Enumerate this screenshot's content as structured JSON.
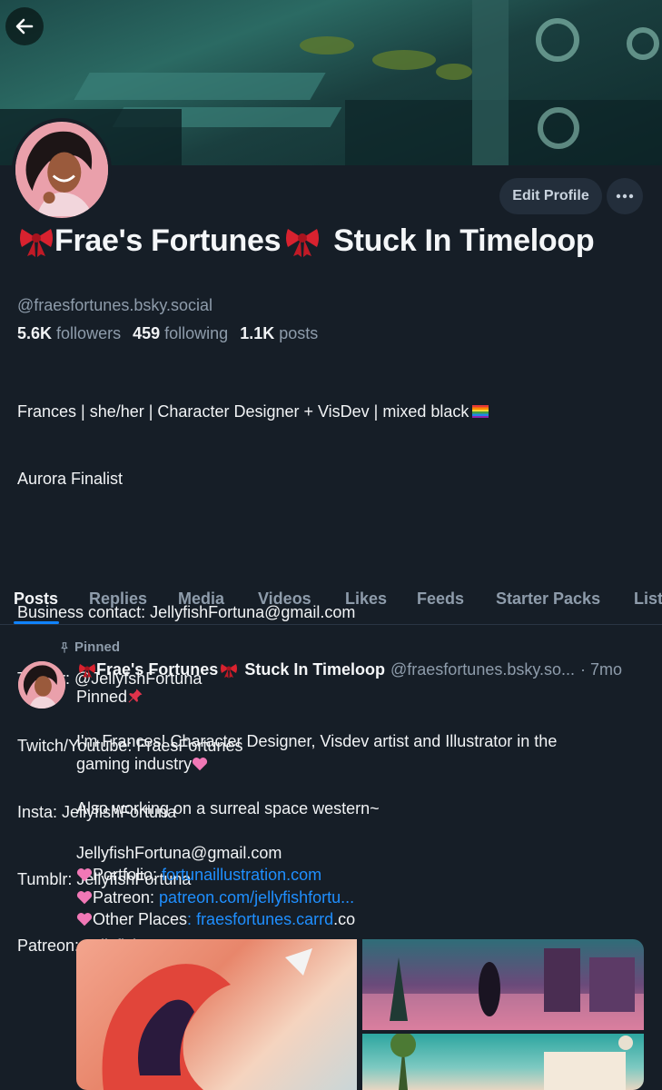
{
  "profile": {
    "display_name": "Frae's Fortunes",
    "display_name_suffix": "Stuck In Timeloop",
    "handle": "@fraesfortunes.bsky.social",
    "edit_label": "Edit Profile",
    "followers_count": "5.6K",
    "followers_label": "followers",
    "following_count": "459",
    "following_label": "following",
    "posts_count": "1.1K",
    "posts_label": "posts",
    "bio": [
      "Frances | she/her | Character Designer + VisDev | mixed black",
      "Aurora Finalist",
      "",
      "Business contact: JellyfishFortuna@gmail.com",
      "Twitter: @JellyfshFortuna",
      "Twitch/Youtube: FraesFortunes",
      "Insta: JellyfishFortuna",
      "Tumblr: JellyfishFortuna",
      "Patreon: JellyfishFortuna"
    ]
  },
  "tabs": [
    {
      "label": "Posts",
      "active": true
    },
    {
      "label": "Replies"
    },
    {
      "label": "Media"
    },
    {
      "label": "Videos"
    },
    {
      "label": "Likes"
    },
    {
      "label": "Feeds"
    },
    {
      "label": "Starter Packs"
    },
    {
      "label": "List"
    }
  ],
  "post": {
    "pinned_label": "Pinned",
    "author_name": "Frae's Fortunes",
    "author_suffix": "Stuck In Timeloop",
    "author_handle": "@fraesfortunes.bsky.so...",
    "time": "· 7mo",
    "line_pinned": "Pinned",
    "line_intro_1": "I'm Frances! Character Designer, Visdev artist and Illustrator in the",
    "line_intro_2": "gaming industry",
    "line_space": "Also working on a surreal space western~",
    "line_email": "JellyfishFortuna@gmail.com",
    "portfolio_label": "Portfolio: ",
    "portfolio_link": "fortunaillustration.com",
    "patreon_label": "Patreon: ",
    "patreon_link": "patreon.com/jellyfishfortu...",
    "other_label": "Other Places",
    "other_sep": ": ",
    "other_link": "fraesfortunes.carrd",
    "other_tail": ".co"
  },
  "colors": {
    "background": "#161e27",
    "accent": "#1083fe",
    "link": "#1f8fff",
    "muted": "#8e9cab"
  },
  "icons": [
    "back-arrow-icon",
    "more-horizontal-icon",
    "pin-icon",
    "ribbon-bow-icon",
    "pink-heart-icon",
    "pushpin-icon",
    "rainbow-flag-icon"
  ]
}
